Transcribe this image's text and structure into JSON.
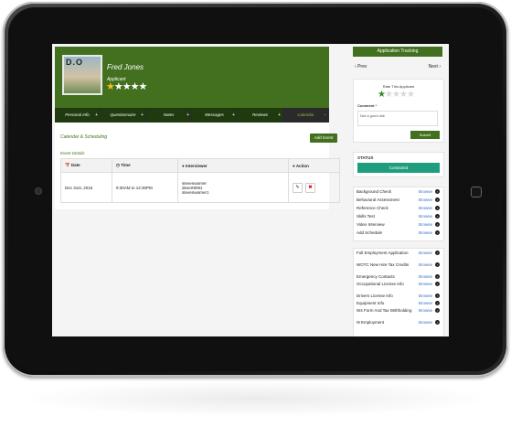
{
  "profile": {
    "name": "Fred Jones",
    "role": "Applicant",
    "avatar_text": "D.O",
    "rating": 1,
    "rating_max": 5
  },
  "tabs": [
    {
      "label": "Personal Info",
      "suffix": "+"
    },
    {
      "label": "Questionnaire",
      "suffix": "+"
    },
    {
      "label": "Notes",
      "suffix": "+"
    },
    {
      "label": "Messages",
      "suffix": "+"
    },
    {
      "label": "Reviews",
      "suffix": "+"
    },
    {
      "label": "Calendar",
      "suffix": "−",
      "active": true
    }
  ],
  "calendar": {
    "title": "Calendar & Scheduling",
    "add_event_label": "Add Event",
    "event_details_label": "Event Details",
    "columns": [
      "Date",
      "Time",
      "Interviewer",
      "Action"
    ],
    "rows": [
      {
        "date": "Dec 31st, 2015",
        "time": "9:30AM to 12:30PM",
        "interviewer_lines": [
          "stevenwarner",
          "desert9091",
          "stevenwarner1"
        ]
      }
    ]
  },
  "sidebar": {
    "app_tracking_label": "Application Tracking",
    "prev_label": "Prev",
    "next_label": "Next",
    "rate_title": "Rate This Applicant",
    "rating": 1,
    "rating_max": 5,
    "comment_label": "Comment",
    "comment_required": "*",
    "comment_value": "Not a good risk",
    "submit_label": "Submit",
    "status_title": "STATUS",
    "status_value": "Contacted",
    "browse_label": "Browse",
    "checks": [
      "Background Check",
      "Behavioral Assessment",
      "Reference Check",
      "Skills Test",
      "Video Interview",
      "Add Schedule"
    ],
    "forms": [
      "Full Employment Application",
      "WOTC New Hire Tax Credits",
      "Emergency Contacts",
      "Occupational License Info",
      "Drivers License Info",
      "Equipment Info",
      "W4 Form And Tax Withholding",
      "I9 Employment"
    ]
  },
  "colors": {
    "brand_green": "#43701f",
    "status_teal": "#1e9e7e",
    "star_gold": "#f2c21b",
    "link_blue": "#3a6fc4"
  }
}
